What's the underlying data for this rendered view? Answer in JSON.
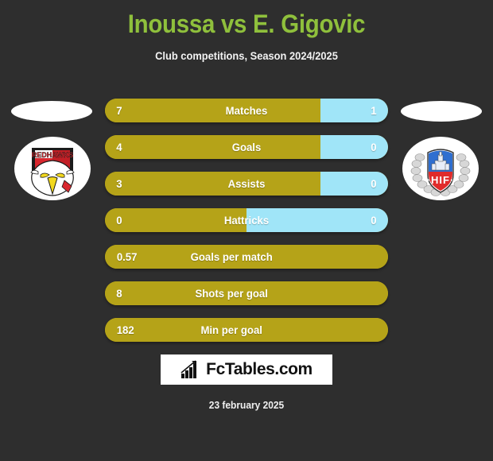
{
  "header": {
    "title": "Inoussa vs E. Gigovic",
    "subtitle": "Club competitions, Season 2024/2025",
    "title_color": "#8fc03c"
  },
  "teams": {
    "home": {
      "crest_name": "REDHAWKS"
    },
    "away": {
      "crest_name": "HIF"
    }
  },
  "colors": {
    "background": "#2e2e2e",
    "home_bar": "#b5a318",
    "away_bar": "#a0e5f8",
    "accent_green": "#8fc03c"
  },
  "stats": [
    {
      "label": "Matches",
      "home": "7",
      "away": "1",
      "home_pct": 76,
      "two_sided": true
    },
    {
      "label": "Goals",
      "home": "4",
      "away": "0",
      "home_pct": 76,
      "two_sided": true
    },
    {
      "label": "Assists",
      "home": "3",
      "away": "0",
      "home_pct": 76,
      "two_sided": true
    },
    {
      "label": "Hattricks",
      "home": "0",
      "away": "0",
      "home_pct": 50,
      "two_sided": true
    },
    {
      "label": "Goals per match",
      "home": "0.57",
      "away": "",
      "home_pct": 100,
      "two_sided": false
    },
    {
      "label": "Shots per goal",
      "home": "8",
      "away": "",
      "home_pct": 100,
      "two_sided": false
    },
    {
      "label": "Min per goal",
      "home": "182",
      "away": "",
      "home_pct": 100,
      "two_sided": false
    }
  ],
  "footer": {
    "logo_text": "FcTables.com",
    "logo_icon": "bar-chart-growth-icon",
    "date": "23 february 2025"
  }
}
